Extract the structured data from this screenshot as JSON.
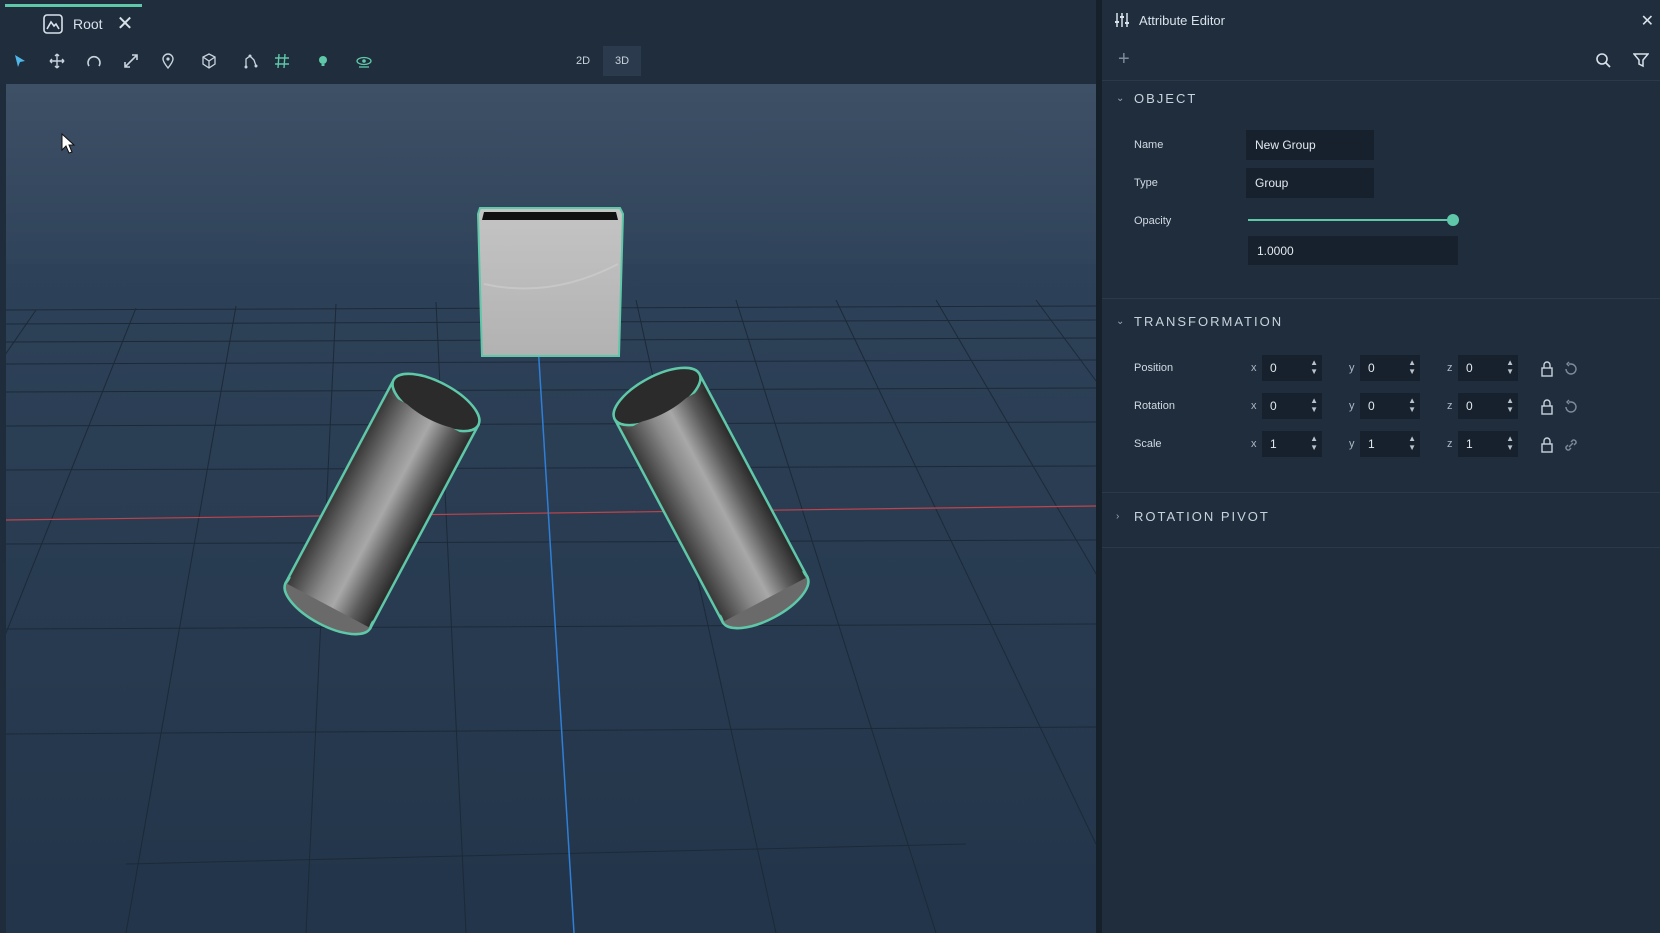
{
  "tabs": [
    {
      "label": "Root"
    }
  ],
  "toolbar": {
    "tools": [
      "select-arrow-icon",
      "move-icon",
      "rotate-icon",
      "scale-icon",
      "location-pin-icon",
      "object-icon",
      "snap-points-icon",
      "grid-icon",
      "light-icon",
      "camera-view-icon"
    ],
    "view_2d_label": "2D",
    "view_3d_label": "3D",
    "active_view": "3D"
  },
  "panel": {
    "title": "Attribute Editor",
    "object": {
      "heading": "OBJECT",
      "name_label": "Name",
      "name_value": "New Group",
      "type_label": "Type",
      "type_value": "Group",
      "opacity_label": "Opacity",
      "opacity_value": "1.0000",
      "opacity_fraction": 1.0
    },
    "transformation": {
      "heading": "TRANSFORMATION",
      "rows": [
        {
          "label": "Position",
          "x": "0",
          "y": "0",
          "z": "0"
        },
        {
          "label": "Rotation",
          "x": "0",
          "y": "0",
          "z": "0"
        },
        {
          "label": "Scale",
          "x": "1",
          "y": "1",
          "z": "1"
        }
      ],
      "axis_labels": {
        "x": "x",
        "y": "y",
        "z": "z"
      }
    },
    "rotation_pivot": {
      "heading": "ROTATION PIVOT"
    }
  },
  "colors": {
    "accent": "#5fc8a8",
    "panel_bg": "#1f2d3d",
    "field_bg": "#16212d",
    "x_axis": "#c0444a",
    "y_axis": "#2f7fd6"
  }
}
